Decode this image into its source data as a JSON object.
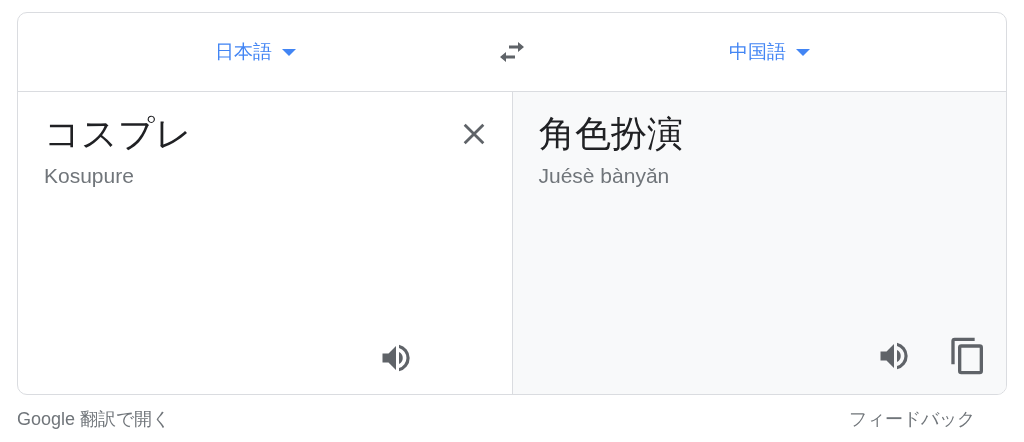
{
  "language_bar": {
    "source_language": "日本語",
    "target_language": "中国語"
  },
  "source": {
    "text": "コスプレ",
    "romanization": "Kosupure"
  },
  "target": {
    "text": "角色扮演",
    "romanization": "Juésè bànyǎn"
  },
  "footer": {
    "open_link": "Google 翻訳で開く",
    "feedback_link": "フィードバック"
  }
}
